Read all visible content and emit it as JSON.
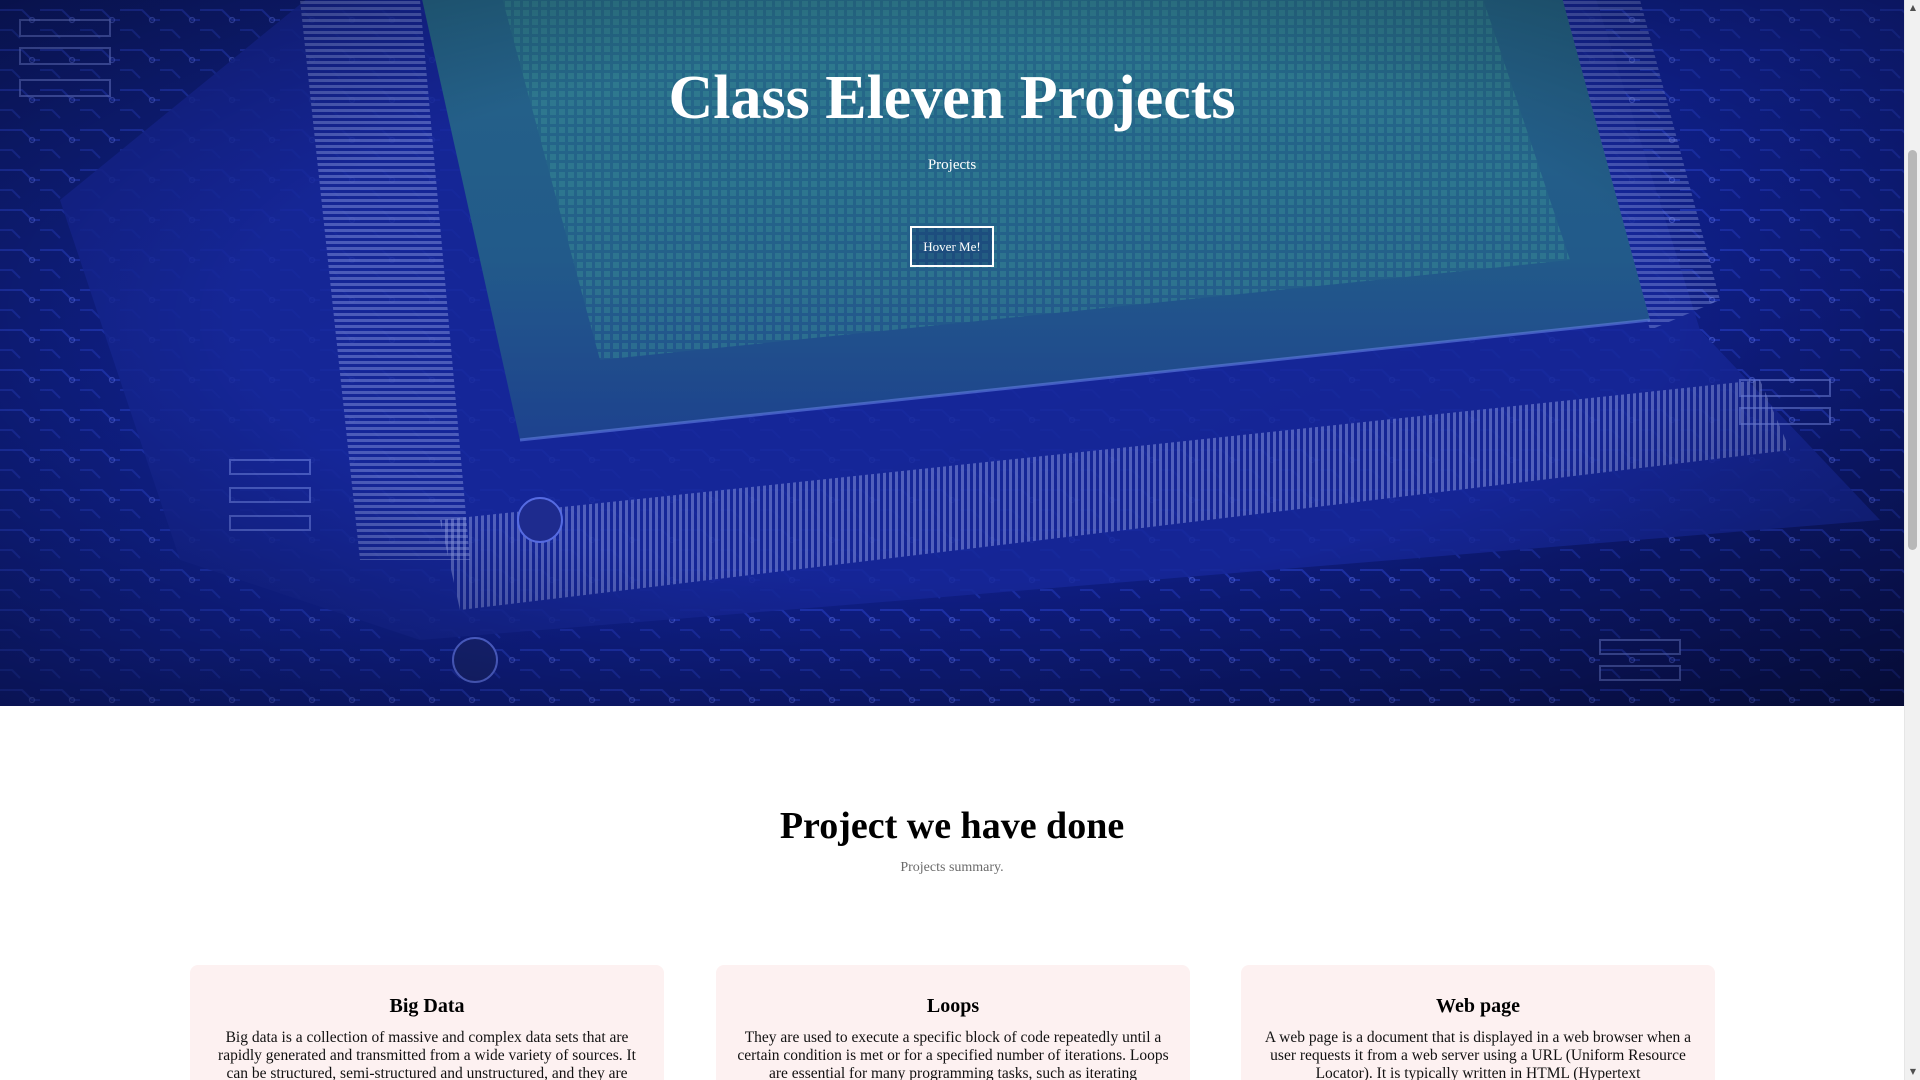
{
  "hero": {
    "title": "Class Eleven Projects",
    "subtitle": "Projects",
    "button_label": "Hover Me!",
    "background": "circuit-board-chip-image",
    "overlay_color": "#0b1a8a"
  },
  "section": {
    "title": "Project we have done",
    "subtitle": "Projects summary."
  },
  "cards": [
    {
      "title": "Big Data",
      "text": "Big data is a collection of massive and complex data sets that are rapidly generated and transmitted from a wide variety of sources. It can be structured, semi-structured and unstructured, and they are"
    },
    {
      "title": "Loops",
      "text": "They are used to execute a specific block of code repeatedly until a certain condition is met or for a specified number of iterations. Loops are essential for many programming tasks, such as iterating"
    },
    {
      "title": "Web page",
      "text": "A web page is a document that is displayed in a web browser when a user requests it from a web server using a URL (Uniform Resource Locator). It is typically written in HTML (Hypertext"
    }
  ],
  "colors": {
    "card_background": "#fdf1f1",
    "chip_green": "#3fbf8f",
    "board_blue": "#1b2fa8"
  },
  "icons": {
    "scroll_up": "▲",
    "scroll_down": "▼"
  }
}
